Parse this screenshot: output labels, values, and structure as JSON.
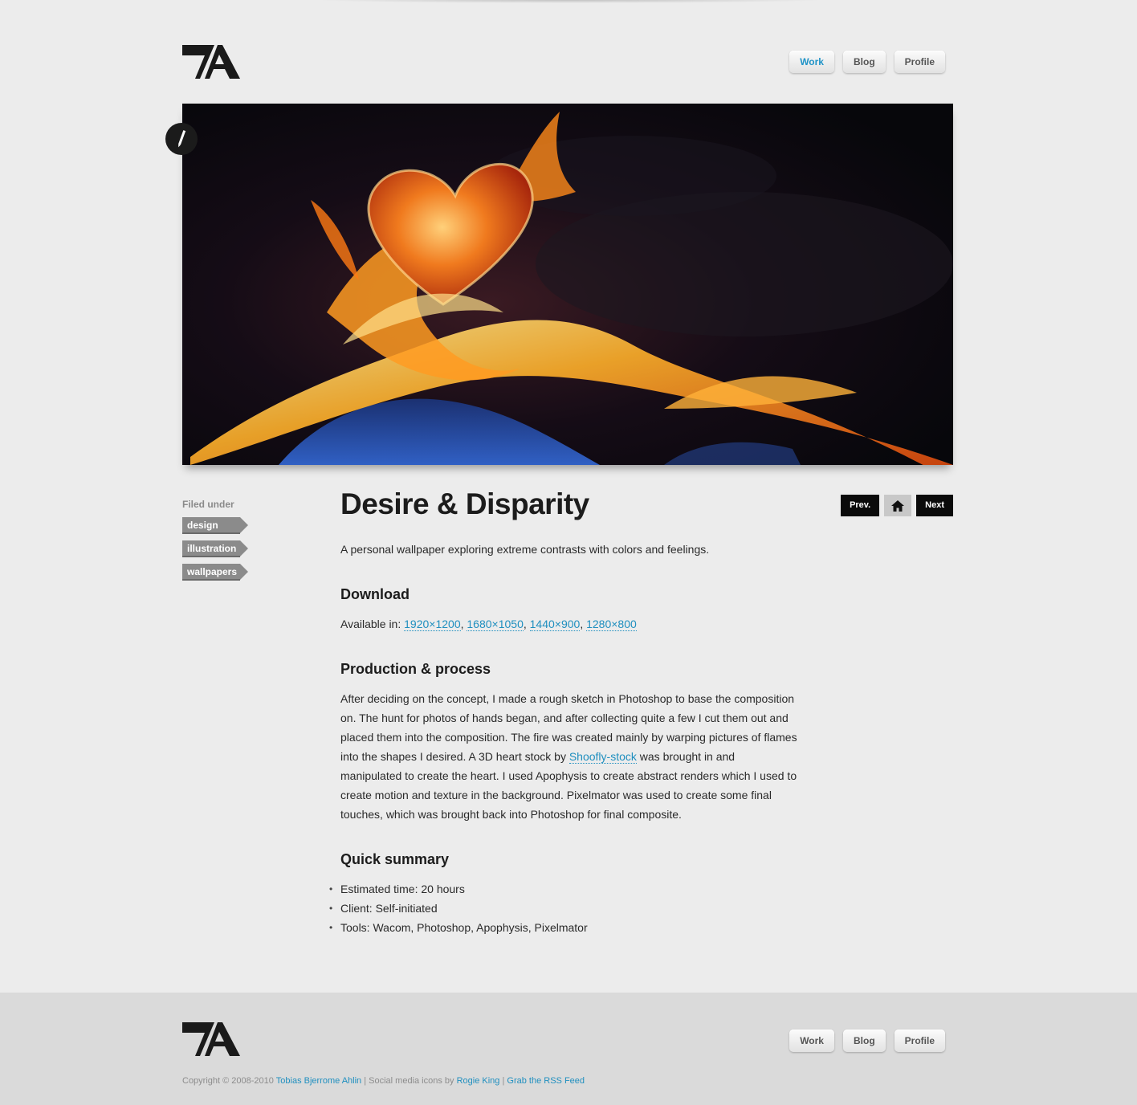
{
  "header": {
    "logo_alt": "TA",
    "nav": [
      {
        "label": "Work",
        "active": true
      },
      {
        "label": "Blog",
        "active": false
      },
      {
        "label": "Profile",
        "active": false
      }
    ]
  },
  "hero": {
    "image_alt": "Flaming heart artwork",
    "badge_icon": "pencil-icon"
  },
  "sidebar": {
    "filed_label": "Filed under",
    "tags": [
      "design",
      "illustration",
      "wallpapers"
    ]
  },
  "article": {
    "title": "Desire & Disparity",
    "intro": "A personal wallpaper exploring extreme contrasts with colors and feelings.",
    "download": {
      "heading": "Download",
      "available_label": "Available in:",
      "sizes": [
        "1920×1200",
        "1680×1050",
        "1440×900",
        "1280×800"
      ]
    },
    "production": {
      "heading": "Production & process",
      "text_before": "After deciding on the concept, I made a rough sketch in Photoshop to base the composition on. The hunt for photos of hands began, and after collecting quite a few I cut them out and placed them into the composition. The fire was created mainly by warping pictures of flames into the shapes I desired. A 3D heart stock by",
      "link": "Shoofly-stock",
      "text_after": "was brought in and manipulated to create the heart. I used Apophysis to create abstract renders which I used to create motion and texture in the background. Pixelmator was used to create some final touches, which was brought back into Photoshop for final composite."
    },
    "summary": {
      "heading": "Quick summary",
      "items": [
        "Estimated time: 20 hours",
        "Client: Self-initiated",
        "Tools: Wacom, Photoshop, Apophysis, Pixelmator"
      ]
    }
  },
  "pager": {
    "prev": "Prev.",
    "next": "Next",
    "home_icon": "home-icon"
  },
  "footer": {
    "nav": [
      "Work",
      "Blog",
      "Profile"
    ],
    "copyright_text": "Copyright © 2008-2010",
    "author": "Tobias Bjerrome Ahlin",
    "sep1": "|",
    "icons_text": "Social media icons by",
    "icons_author": "Rogie King",
    "sep2": "|",
    "rss": "Grab the RSS Feed"
  },
  "colors": {
    "background": "#ececec",
    "accent": "#1f93c7",
    "footer_bg": "#dadada",
    "tag_bg": "#8b8b8b"
  }
}
